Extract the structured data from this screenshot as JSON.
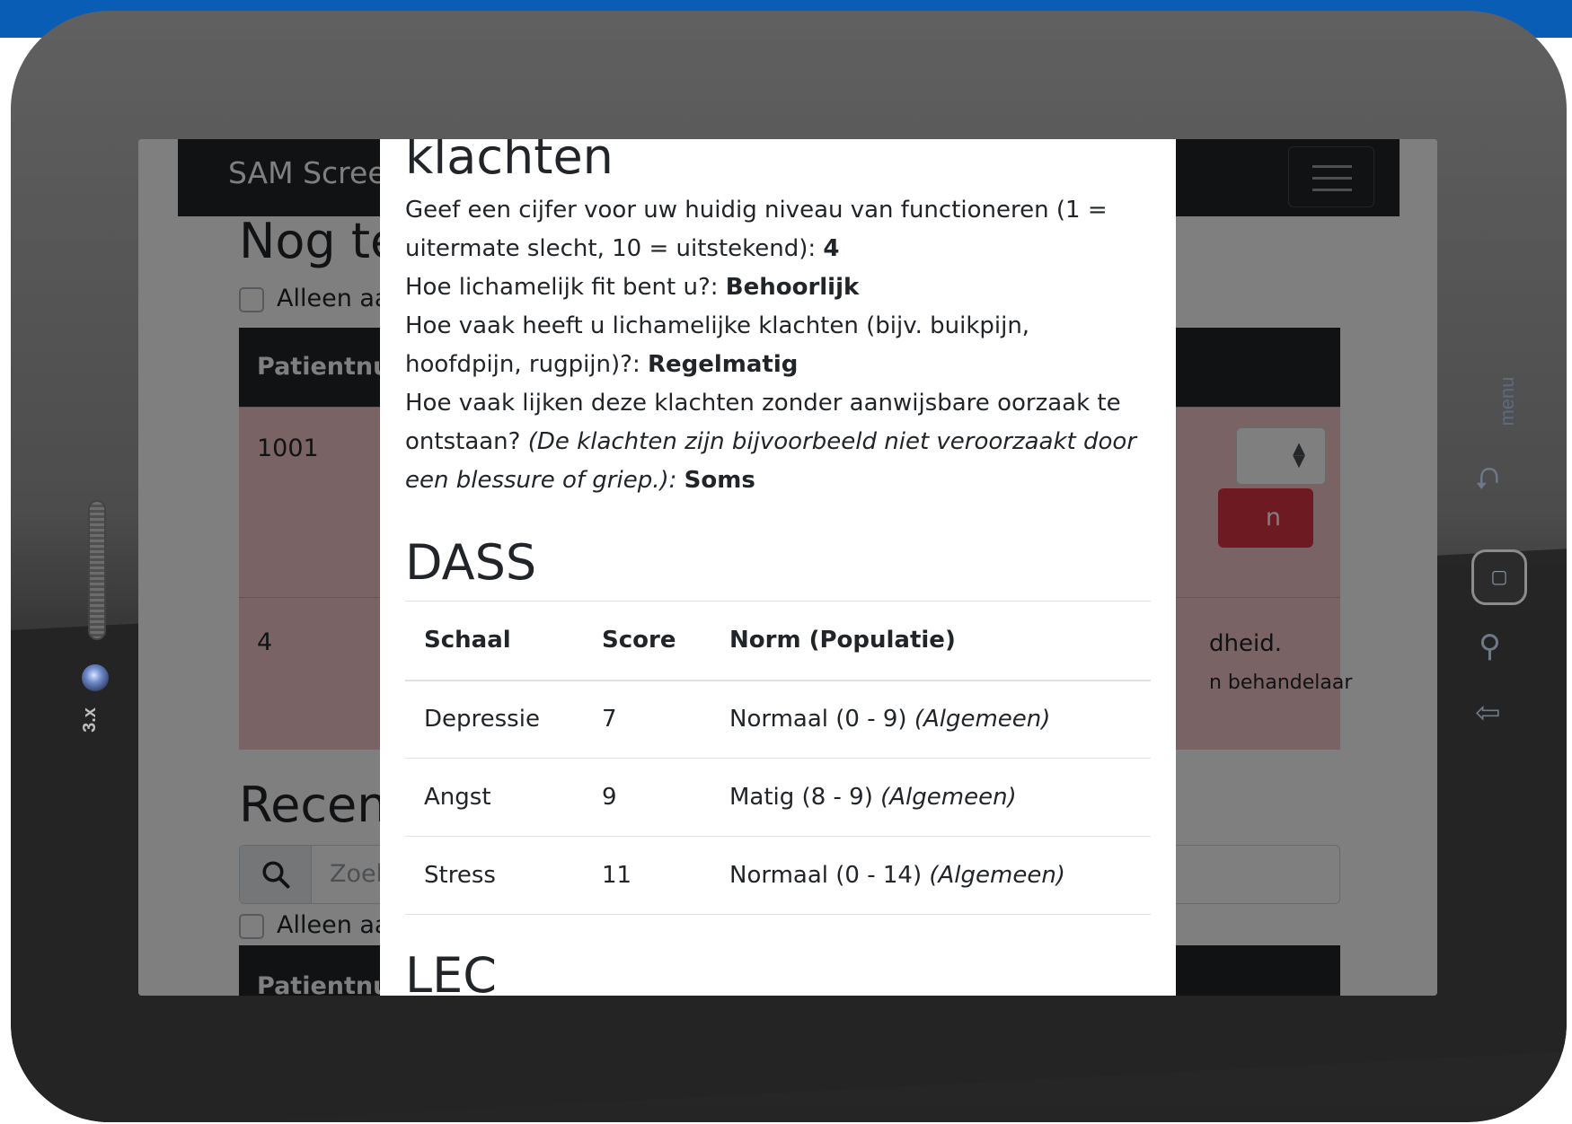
{
  "device": {
    "zoom_label": "3.x",
    "menu_label": "menu"
  },
  "app": {
    "brand": "SAM Scree",
    "section1_title": "Nog te",
    "filter_label": "Alleen aa",
    "table_header": "Patientnu",
    "rows": [
      {
        "number": "1001",
        "button_text": "n"
      },
      {
        "number": "4",
        "text1": "dheid.",
        "text2": "n behandelaar"
      }
    ],
    "section2_title": "Recen",
    "search_placeholder": "Zoek",
    "filter2_label": "Alleen aa",
    "table2_header": "Patientnu"
  },
  "modal": {
    "section_title": "klachten",
    "questions": [
      {
        "q": "Geef een cijfer voor uw huidig niveau van functioneren (1 = uitermate slecht, 10 = uitstekend):",
        "a": "4"
      },
      {
        "q": "Hoe lichamelijk fit bent u?:",
        "a": "Behoorlijk"
      },
      {
        "q": "Hoe vaak heeft u lichamelijke klachten (bijv. buikpijn, hoofdpijn, rugpijn)?:",
        "a": "Regelmatig"
      },
      {
        "q": "Hoe vaak lijken deze klachten zonder aanwijsbare oorzaak te ontstaan?",
        "note": "(De klachten zijn bijvoorbeeld niet veroorzaakt door een blessure of griep.):",
        "a": "Soms"
      }
    ],
    "dass_title": "DASS",
    "dass_columns": [
      "Schaal",
      "Score",
      "Norm (Populatie)"
    ],
    "dass_rows": [
      {
        "scale": "Depressie",
        "score": "7",
        "norm": "Normaal (0 - 9)",
        "population": "(Algemeen)"
      },
      {
        "scale": "Angst",
        "score": "9",
        "norm": "Matig (8 - 9)",
        "population": "(Algemeen)"
      },
      {
        "scale": "Stress",
        "score": "11",
        "norm": "Normaal (0 - 14)",
        "population": "(Algemeen)"
      }
    ],
    "lec_title": "LEC"
  }
}
